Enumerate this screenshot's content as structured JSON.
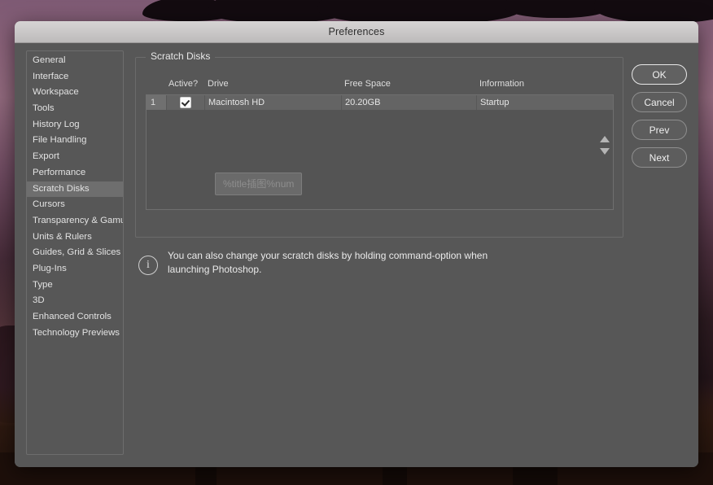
{
  "window": {
    "title": "Preferences"
  },
  "sidebar": {
    "items": [
      {
        "label": "General",
        "selected": false
      },
      {
        "label": "Interface",
        "selected": false
      },
      {
        "label": "Workspace",
        "selected": false
      },
      {
        "label": "Tools",
        "selected": false
      },
      {
        "label": "History Log",
        "selected": false
      },
      {
        "label": "File Handling",
        "selected": false
      },
      {
        "label": "Export",
        "selected": false
      },
      {
        "label": "Performance",
        "selected": false
      },
      {
        "label": "Scratch Disks",
        "selected": true
      },
      {
        "label": "Cursors",
        "selected": false
      },
      {
        "label": "Transparency & Gamut",
        "selected": false
      },
      {
        "label": "Units & Rulers",
        "selected": false
      },
      {
        "label": "Guides, Grid & Slices",
        "selected": false
      },
      {
        "label": "Plug-Ins",
        "selected": false
      },
      {
        "label": "Type",
        "selected": false
      },
      {
        "label": "3D",
        "selected": false
      },
      {
        "label": "Enhanced Controls",
        "selected": false
      },
      {
        "label": "Technology Previews",
        "selected": false
      }
    ]
  },
  "main": {
    "group_label": "Scratch Disks",
    "table": {
      "columns": [
        "",
        "Active?",
        "Drive",
        "Free Space",
        "Information"
      ],
      "rows": [
        {
          "index": "1",
          "active": true,
          "drive": "Macintosh HD",
          "free_space": "20.20GB",
          "information": "Startup"
        }
      ]
    },
    "overlay_tip": "%title插图%num",
    "note": "You can also change your scratch disks by holding command-option when launching Photoshop.",
    "info_icon": "i"
  },
  "buttons": [
    {
      "label": "OK",
      "primary": true
    },
    {
      "label": "Cancel",
      "primary": false
    },
    {
      "label": "Prev",
      "primary": false
    },
    {
      "label": "Next",
      "primary": false
    }
  ],
  "icons": {
    "scroll_up": "arrow-up-icon",
    "scroll_down": "arrow-down-icon"
  }
}
